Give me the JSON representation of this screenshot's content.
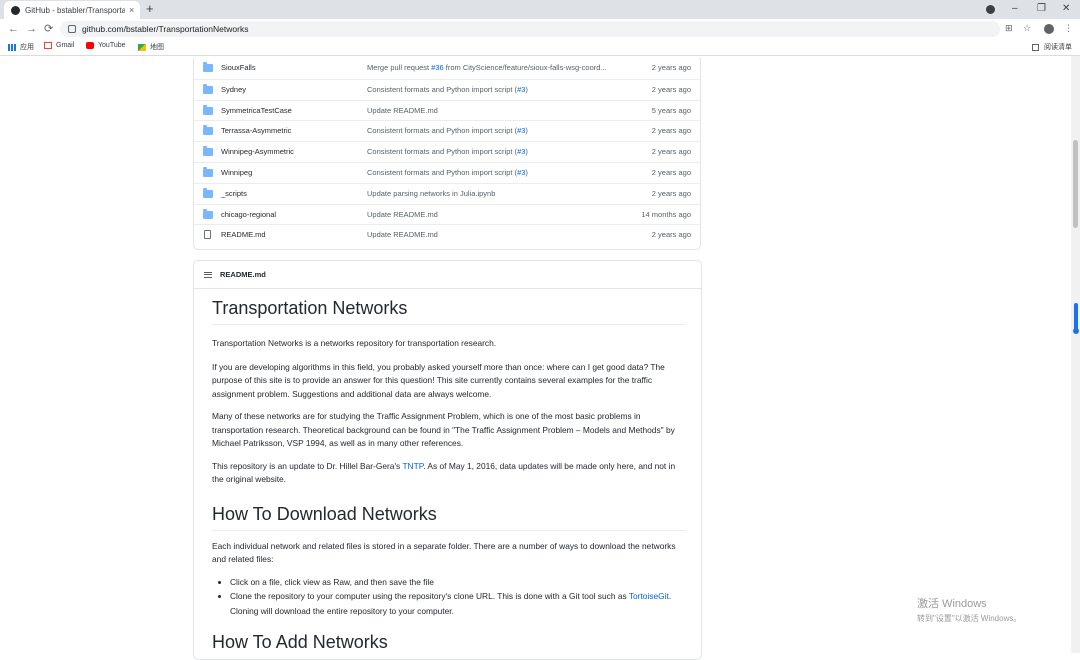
{
  "browser": {
    "tab_title": "GitHub - bstabler/Transportati",
    "tab_close": "×",
    "new_tab": "+",
    "url": "github.com/bstabler/TransportationNetworks",
    "bookmarks": [
      {
        "label": "应用"
      },
      {
        "label": "Gmail"
      },
      {
        "label": "YouTube"
      },
      {
        "label": "地图"
      }
    ],
    "reading_list": "阅读清单",
    "window_controls": {
      "minimize": "–",
      "restore": "❐",
      "close": "✕"
    }
  },
  "files": [
    {
      "type": "folder",
      "name": "SiouxFalls",
      "msg_pre": "Merge pull request ",
      "msg_link": "#36",
      "msg_post": " from CityScience/feature/sioux-falls-wsg-coord...",
      "age": "2 years ago"
    },
    {
      "type": "folder",
      "name": "Sydney",
      "msg_pre": "Consistent formats and Python import script (",
      "msg_link": "#3",
      "msg_post": ")",
      "age": "2 years ago"
    },
    {
      "type": "folder",
      "name": "SymmetricaTestCase",
      "msg_pre": "Update README.md",
      "msg_link": "",
      "msg_post": "",
      "age": "5 years ago"
    },
    {
      "type": "folder",
      "name": "Terrassa-Asymmetric",
      "msg_pre": "Consistent formats and Python import script (",
      "msg_link": "#3",
      "msg_post": ")",
      "age": "2 years ago"
    },
    {
      "type": "folder",
      "name": "Winnipeg-Asymmetric",
      "msg_pre": "Consistent formats and Python import script (",
      "msg_link": "#3",
      "msg_post": ")",
      "age": "2 years ago"
    },
    {
      "type": "folder",
      "name": "Winnipeg",
      "msg_pre": "Consistent formats and Python import script (",
      "msg_link": "#3",
      "msg_post": ")",
      "age": "2 years ago"
    },
    {
      "type": "folder",
      "name": "_scripts",
      "msg_pre": "Update parsing networks in Julia.ipynb",
      "msg_link": "",
      "msg_post": "",
      "age": "2 years ago"
    },
    {
      "type": "folder",
      "name": "chicago-regional",
      "msg_pre": "Update README.md",
      "msg_link": "",
      "msg_post": "",
      "age": "14 months ago"
    },
    {
      "type": "file",
      "name": "README.md",
      "msg_pre": "Update README.md",
      "msg_link": "",
      "msg_post": "",
      "age": "2 years ago"
    }
  ],
  "readme": {
    "header": "README.md",
    "h1": "Transportation Networks",
    "p1": "Transportation Networks is a networks repository for transportation research.",
    "p2": "If you are developing algorithms in this field, you probably asked yourself more than once: where can I get good data? The purpose of this site is to provide an answer for this question! This site currently contains several examples for the traffic assignment problem. Suggestions and additional data are always welcome.",
    "p3": "Many of these networks are for studying the Traffic Assignment Problem, which is one of the most basic problems in transportation research. Theoretical background can be found in \"The Traffic Assignment Problem – Models and Methods\" by Michael Patriksson, VSP 1994, as well as in many other references.",
    "p4_pre": "This repository is an update to Dr. Hillel Bar-Gera's ",
    "p4_link": "TNTP",
    "p4_post": ". As of May 1, 2016, data updates will be made only here, and not in the original website.",
    "h2": "How To Download Networks",
    "p5": "Each individual network and related files is stored in a separate folder. There are a number of ways to download the networks and related files:",
    "li1": "Click on a file, click view as Raw, and then save the file",
    "li2_pre": "Clone the repository to your computer using the repository's clone URL. This is done with a Git tool such as ",
    "li2_link": "TortoiseGit",
    "li2_post": ". Cloning will download the entire repository to your computer.",
    "h3": "How To Add Networks"
  },
  "watermark": {
    "line1": "激活 Windows",
    "line2": "转到\"设置\"以激活 Windows。"
  }
}
